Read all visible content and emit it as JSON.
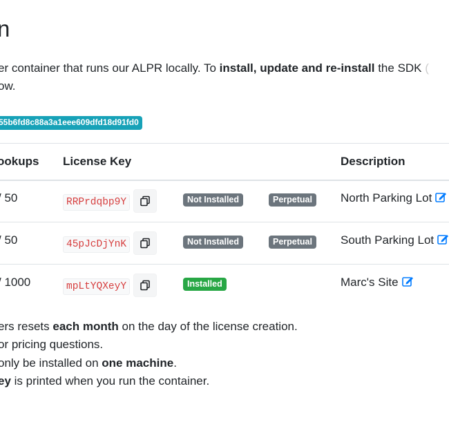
{
  "page": {
    "title_fragment": "n",
    "intro_line1": {
      "pre": "er container that runs our ALPR locally. To ",
      "bold": "install, update and re-install",
      "post": " the SDK "
    },
    "intro_line2": "ow.",
    "token": "55b6fd8c88a3a1eee609dfd18d91fd0"
  },
  "table": {
    "headers": {
      "lookups": "ookups",
      "license_key": "License Key",
      "description": "Description"
    },
    "rows": [
      {
        "lookups": "/ 50",
        "key": "RRPrdqbp9Y",
        "status": "Not Installed",
        "type": "Perpetual",
        "description": "North Parking Lot"
      },
      {
        "lookups": "/ 50",
        "key": "45pJcDjYnK",
        "status": "Not Installed",
        "type": "Perpetual",
        "description": "South Parking Lot"
      },
      {
        "lookups": "/ 1000",
        "key": "mpLtYQXeyY",
        "status": "Installed",
        "type": "",
        "description": "Marc's Site"
      }
    ]
  },
  "notes": [
    {
      "pre": "ers resets ",
      "bold": "each month",
      "post": " on the day of the license creation."
    },
    {
      "pre": "or pricing questions.",
      "bold": "",
      "post": ""
    },
    {
      "pre": "only be installed on ",
      "bold": "one machine",
      "post": "."
    },
    {
      "pre": "",
      "bold": "ey",
      "post": " is printed when you run the container."
    }
  ],
  "colors": {
    "token_badge": "#17a2b8",
    "not_installed_badge": "#6c757d",
    "perpetual_badge": "#6c757d",
    "installed_badge": "#28a745",
    "license_key_text": "#d63d3d",
    "edit_icon": "#007bff"
  },
  "icons": {
    "copy": "copy-icon",
    "edit": "edit-icon"
  }
}
